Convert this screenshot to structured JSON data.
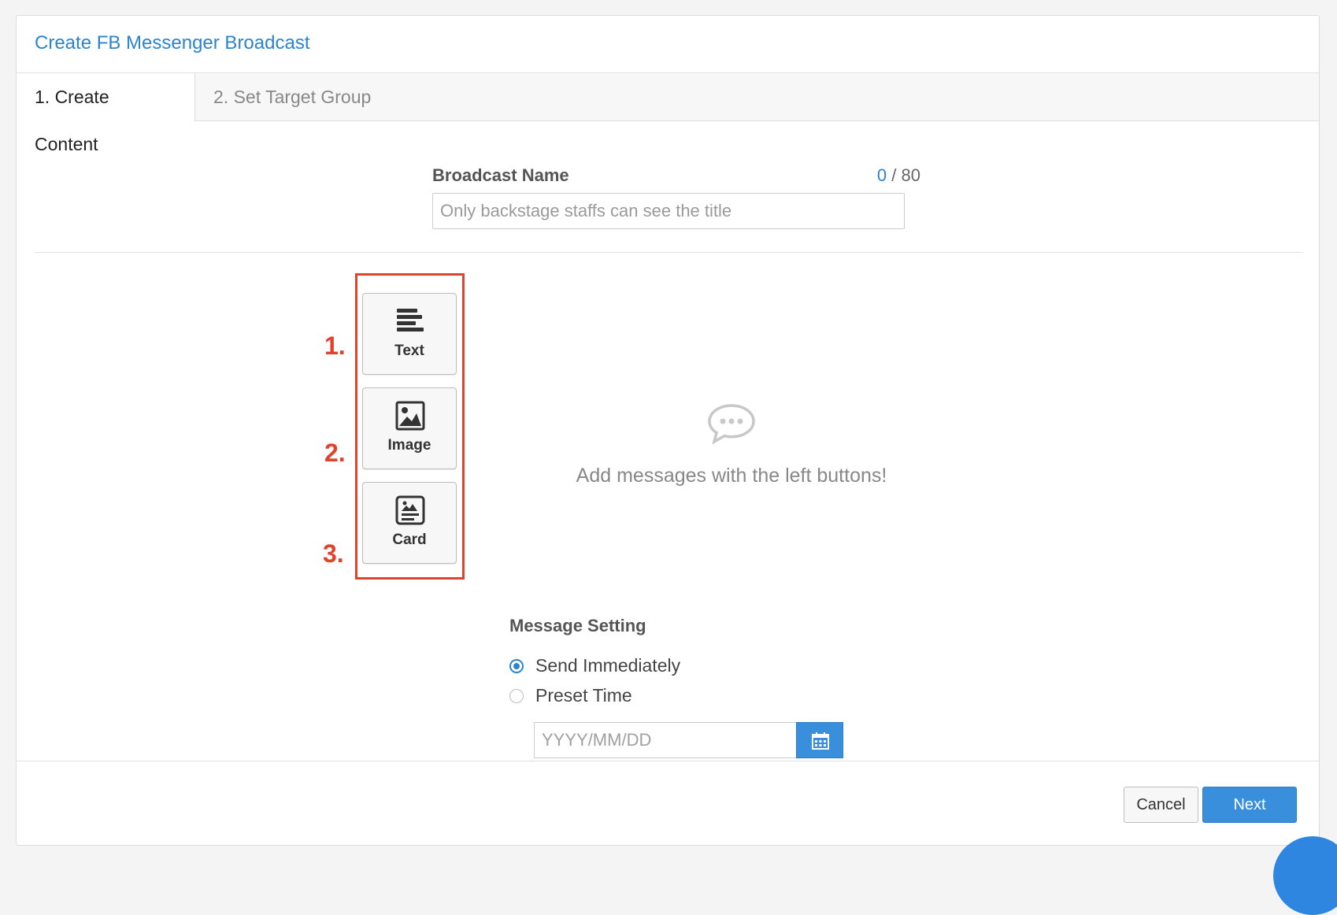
{
  "header": {
    "title": "Create FB Messenger Broadcast"
  },
  "tabs": [
    {
      "label": "1. Create Content",
      "active": true
    },
    {
      "label": "2. Set Target Group",
      "active": false
    }
  ],
  "broadcast_name": {
    "label": "Broadcast Name",
    "count": "0",
    "max": "/ 80",
    "placeholder": "Only backstage staffs can see the title"
  },
  "message_buttons": [
    {
      "number": "1.",
      "label": "Text",
      "icon": "text-lines-icon"
    },
    {
      "number": "2.",
      "label": "Image",
      "icon": "image-icon"
    },
    {
      "number": "3.",
      "label": "Card",
      "icon": "card-icon"
    }
  ],
  "empty_state": {
    "icon": "chat-bubble-icon",
    "text": "Add messages with the left buttons!"
  },
  "message_setting": {
    "label": "Message Setting",
    "options": [
      {
        "label": "Send Immediately",
        "checked": true
      },
      {
        "label": "Preset Time",
        "checked": false
      }
    ],
    "date_placeholder": "YYYY/MM/DD"
  },
  "footer": {
    "cancel_label": "Cancel",
    "next_label": "Next"
  },
  "colors": {
    "accent": "#2a84d2",
    "highlight": "#e0432b",
    "primary_button": "#3a8fdc"
  }
}
